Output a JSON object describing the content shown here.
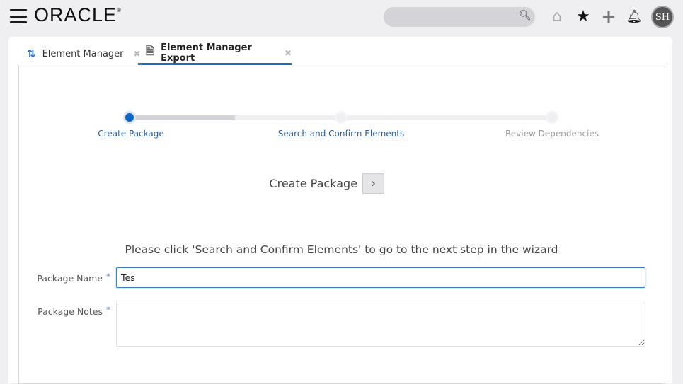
{
  "header": {
    "logo": "ORACLE",
    "search_placeholder": "",
    "avatar_initials": "SH"
  },
  "tabs": [
    {
      "label": "Element Manager",
      "close": "✖"
    },
    {
      "label": "Element Manager Export",
      "close": "✖",
      "active": true
    }
  ],
  "wizard": {
    "steps": [
      {
        "label": "Create Package",
        "state": "current"
      },
      {
        "label": "Search and Confirm Elements",
        "state": "pending"
      },
      {
        "label": "Review Dependencies",
        "state": "pending"
      }
    ],
    "progress_percent": 25,
    "current_title": "Create Package",
    "next_label": "›"
  },
  "instruction": "Please click 'Search and Confirm Elements' to go to the next step in the wizard",
  "form": {
    "package_name_label": "Package Name",
    "package_name_value": "Tes",
    "package_notes_label": "Package Notes",
    "package_notes_value": "",
    "required_marker": "*"
  },
  "colors": {
    "accent": "#1f6fc5",
    "step_active": "#0b63c4"
  }
}
